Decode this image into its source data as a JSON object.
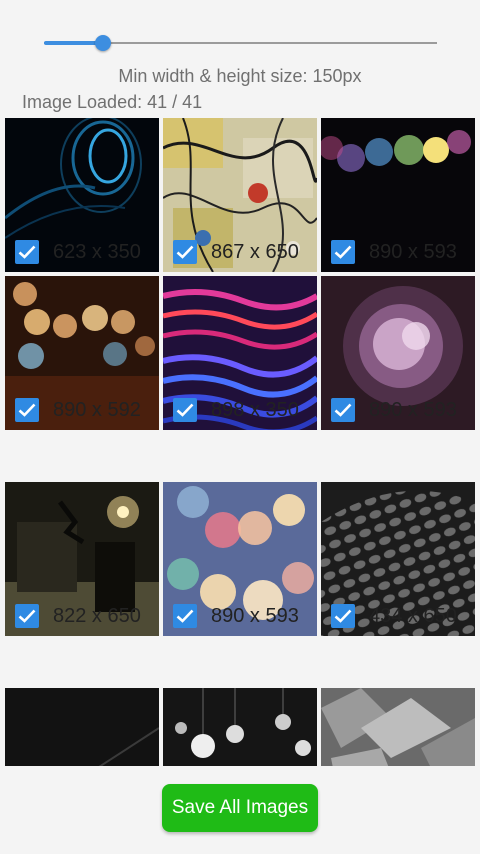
{
  "slider": {
    "level": 0.15
  },
  "labels": {
    "min_size": "Min width & height size: 150px",
    "loaded": "Image Loaded: 41 / 41"
  },
  "images": [
    {
      "dims": "623 x 350",
      "checked": true,
      "icon": "blue-light-swirl-image"
    },
    {
      "dims": "867 x 650",
      "checked": true,
      "icon": "abstract-paint-splatter-image"
    },
    {
      "dims": "890 x 593",
      "checked": true,
      "icon": "colorful-bokeh-image"
    },
    {
      "dims": "890 x 592",
      "checked": true,
      "icon": "warm-bokeh-lights-image"
    },
    {
      "dims": "898 x 350",
      "checked": true,
      "icon": "neon-light-waves-image"
    },
    {
      "dims": "890 x 593",
      "checked": true,
      "icon": "purple-glow-image"
    },
    {
      "dims": "822 x 650",
      "checked": true,
      "icon": "haunted-room-image"
    },
    {
      "dims": "890 x 593",
      "checked": true,
      "icon": "pastel-bokeh-image"
    },
    {
      "dims": "434 x 650",
      "checked": true,
      "icon": "dark-hexagon-pattern-image"
    },
    {
      "dims": "",
      "checked": false,
      "icon": "dark-diagonal-image"
    },
    {
      "dims": "",
      "checked": false,
      "icon": "hanging-lamps-image"
    },
    {
      "dims": "",
      "checked": false,
      "icon": "metallic-facets-image"
    }
  ],
  "save_button": {
    "label": "Save All Images"
  },
  "colors": {
    "accent": "#3d8ee0",
    "checkbox": "#2f8ae3",
    "save": "#1fbb16"
  }
}
